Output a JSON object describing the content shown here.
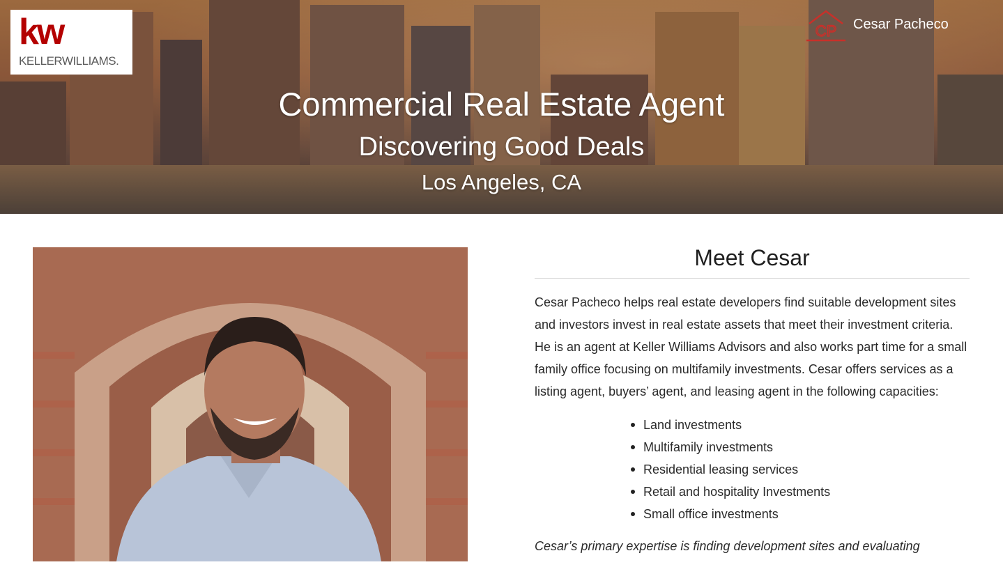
{
  "header": {
    "logo_mark": "kw",
    "logo_name": "KELLERWILLIAMS.",
    "cp_monogram": "CP",
    "agent_name": "Cesar Pacheco",
    "brand_color": "#b40101"
  },
  "hero": {
    "title": "Commercial Real Estate Agent",
    "subtitle": "Discovering Good Deals",
    "location": "Los Angeles, CA"
  },
  "about": {
    "heading": "Meet Cesar",
    "bio": "Cesar Pacheco helps real estate developers find suitable development sites and investors invest in real estate assets that meet their investment criteria. He is an agent at Keller Williams Advisors and also works part time for a small family office focusing on multifamily investments. Cesar offers services as a listing agent, buyers’ agent, and leasing agent in the following capacities:",
    "services": [
      "Land investments",
      "Multifamily investments",
      "Residential leasing services",
      "Retail and hospitality Investments",
      "Small office investments"
    ],
    "more_text": "Cesar’s primary expertise is finding development sites and evaluating"
  }
}
